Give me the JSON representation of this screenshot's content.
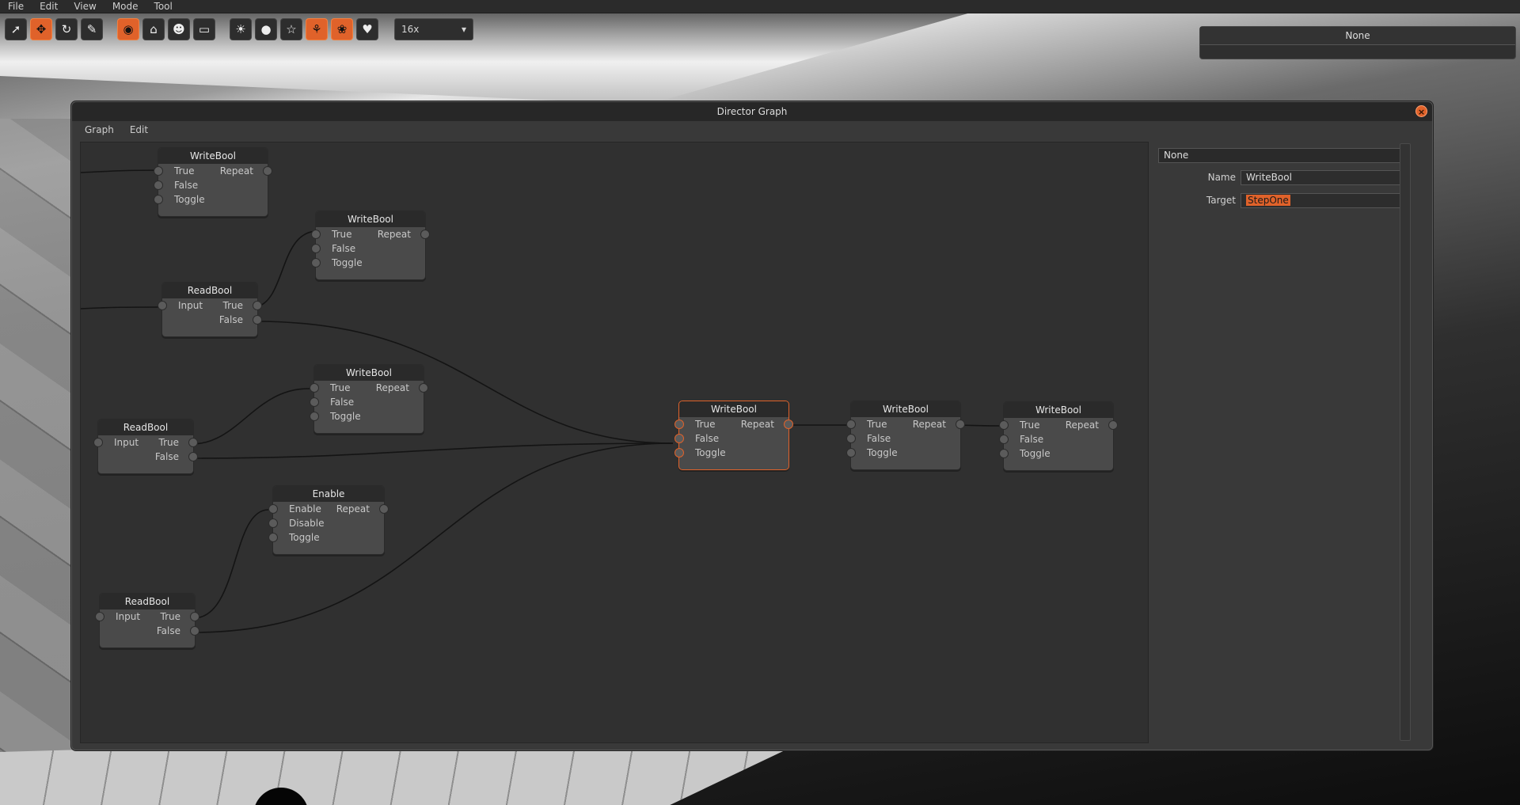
{
  "menubar": {
    "items": [
      "File",
      "Edit",
      "View",
      "Mode",
      "Tool"
    ]
  },
  "toolbar": {
    "zoom_value": "16x",
    "tools": [
      {
        "icon": "select-arrow-icon",
        "active": false
      },
      {
        "icon": "move-icon",
        "active": true
      },
      {
        "icon": "rotate-icon",
        "active": false
      },
      {
        "icon": "wrench-icon",
        "active": false
      }
    ],
    "modes": [
      {
        "icon": "globe-icon",
        "active": true
      },
      {
        "icon": "home-icon",
        "active": false
      },
      {
        "icon": "users-icon",
        "active": false
      },
      {
        "icon": "monitor-icon",
        "active": false
      }
    ],
    "extras": [
      {
        "icon": "lightbulb-icon",
        "active": false
      },
      {
        "icon": "sphere-icon",
        "active": false
      },
      {
        "icon": "star-icon",
        "active": false
      },
      {
        "icon": "butterfly-icon",
        "active": true
      },
      {
        "icon": "paw-icon",
        "active": true
      },
      {
        "icon": "heart-icon",
        "active": false
      }
    ]
  },
  "top_panel": {
    "label": "None"
  },
  "window": {
    "title": "Director Graph",
    "menu": [
      "Graph",
      "Edit"
    ]
  },
  "nodes": [
    {
      "id": "wb1",
      "title": "WriteBool",
      "rows": [
        [
          "True",
          "Repeat"
        ],
        [
          "False",
          ""
        ],
        [
          "Toggle",
          ""
        ]
      ],
      "selected": false
    },
    {
      "id": "wb2",
      "title": "WriteBool",
      "rows": [
        [
          "True",
          "Repeat"
        ],
        [
          "False",
          ""
        ],
        [
          "Toggle",
          ""
        ]
      ],
      "selected": false
    },
    {
      "id": "rb1",
      "title": "ReadBool",
      "rows": [
        [
          "Input",
          "True"
        ],
        [
          "",
          "False"
        ]
      ],
      "selected": false
    },
    {
      "id": "wb3",
      "title": "WriteBool",
      "rows": [
        [
          "True",
          "Repeat"
        ],
        [
          "False",
          ""
        ],
        [
          "Toggle",
          ""
        ]
      ],
      "selected": false
    },
    {
      "id": "rb2",
      "title": "ReadBool",
      "rows": [
        [
          "Input",
          "True"
        ],
        [
          "",
          "False"
        ]
      ],
      "selected": false
    },
    {
      "id": "en1",
      "title": "Enable",
      "rows": [
        [
          "Enable",
          "Repeat"
        ],
        [
          "Disable",
          ""
        ],
        [
          "Toggle",
          ""
        ]
      ],
      "selected": false
    },
    {
      "id": "rb3",
      "title": "ReadBool",
      "rows": [
        [
          "Input",
          "True"
        ],
        [
          "",
          "False"
        ]
      ],
      "selected": false
    },
    {
      "id": "wb4",
      "title": "WriteBool",
      "rows": [
        [
          "True",
          "Repeat"
        ],
        [
          "False",
          ""
        ],
        [
          "Toggle",
          ""
        ]
      ],
      "selected": true
    },
    {
      "id": "wb5",
      "title": "WriteBool",
      "rows": [
        [
          "True",
          "Repeat"
        ],
        [
          "False",
          ""
        ],
        [
          "Toggle",
          ""
        ]
      ],
      "selected": false
    },
    {
      "id": "wb6",
      "title": "WriteBool",
      "rows": [
        [
          "True",
          "Repeat"
        ],
        [
          "False",
          ""
        ],
        [
          "Toggle",
          ""
        ]
      ],
      "selected": false
    }
  ],
  "inspector": {
    "header": "None",
    "name_label": "Name",
    "name_value": "WriteBool",
    "target_label": "Target",
    "target_value": "StepOne"
  },
  "colors": {
    "accent": "#e0622a",
    "panel": "#393939",
    "canvas": "#303030"
  }
}
